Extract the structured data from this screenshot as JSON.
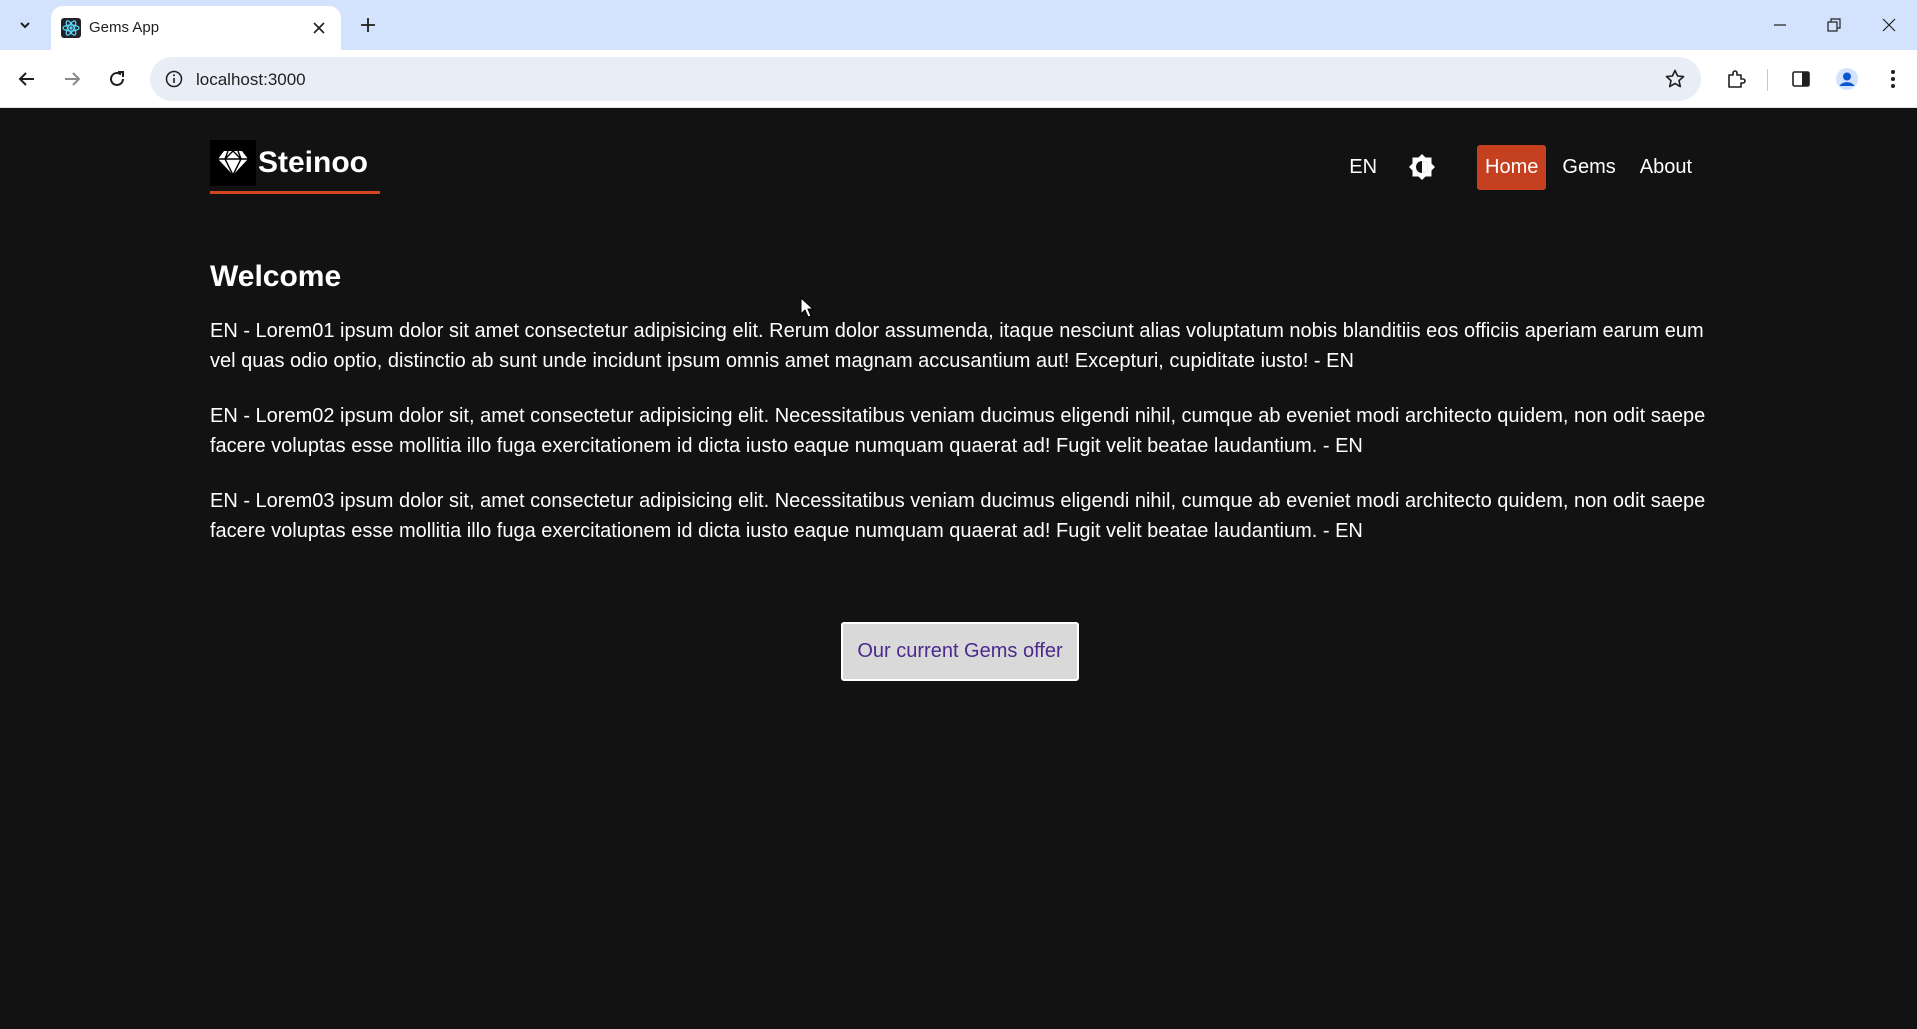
{
  "browser": {
    "tab_title": "Gems App",
    "url": "localhost:3000"
  },
  "nav": {
    "brand": "Steinoo",
    "language": "EN",
    "links": [
      "Home",
      "Gems",
      "About"
    ],
    "active": "Home"
  },
  "main": {
    "title": "Welcome",
    "paragraphs": [
      "EN - Lorem01 ipsum dolor sit amet consectetur adipisicing elit. Rerum dolor assumenda, itaque nesciunt alias voluptatum nobis blanditiis eos officiis aperiam earum eum vel quas odio optio, distinctio ab sunt unde incidunt ipsum omnis amet magnam accusantium aut! Excepturi, cupiditate iusto! - EN",
      "EN - Lorem02 ipsum dolor sit, amet consectetur adipisicing elit. Necessitatibus veniam ducimus eligendi nihil, cumque ab eveniet modi architecto quidem, non odit saepe facere voluptas esse mollitia illo fuga exercitationem id dicta iusto eaque numquam quaerat ad! Fugit velit beatae laudantium. - EN",
      "EN - Lorem03 ipsum dolor sit, amet consectetur adipisicing elit. Necessitatibus veniam ducimus eligendi nihil, cumque ab eveniet modi architecto quidem, non odit saepe facere voluptas esse mollitia illo fuga exercitationem id dicta iusto eaque numquam quaerat ad! Fugit velit beatae laudantium. - EN"
    ],
    "cta": "Our current Gems offer"
  },
  "colors": {
    "background": "#121212",
    "accent": "#c5401f",
    "tabbar": "#d3e3fd"
  }
}
